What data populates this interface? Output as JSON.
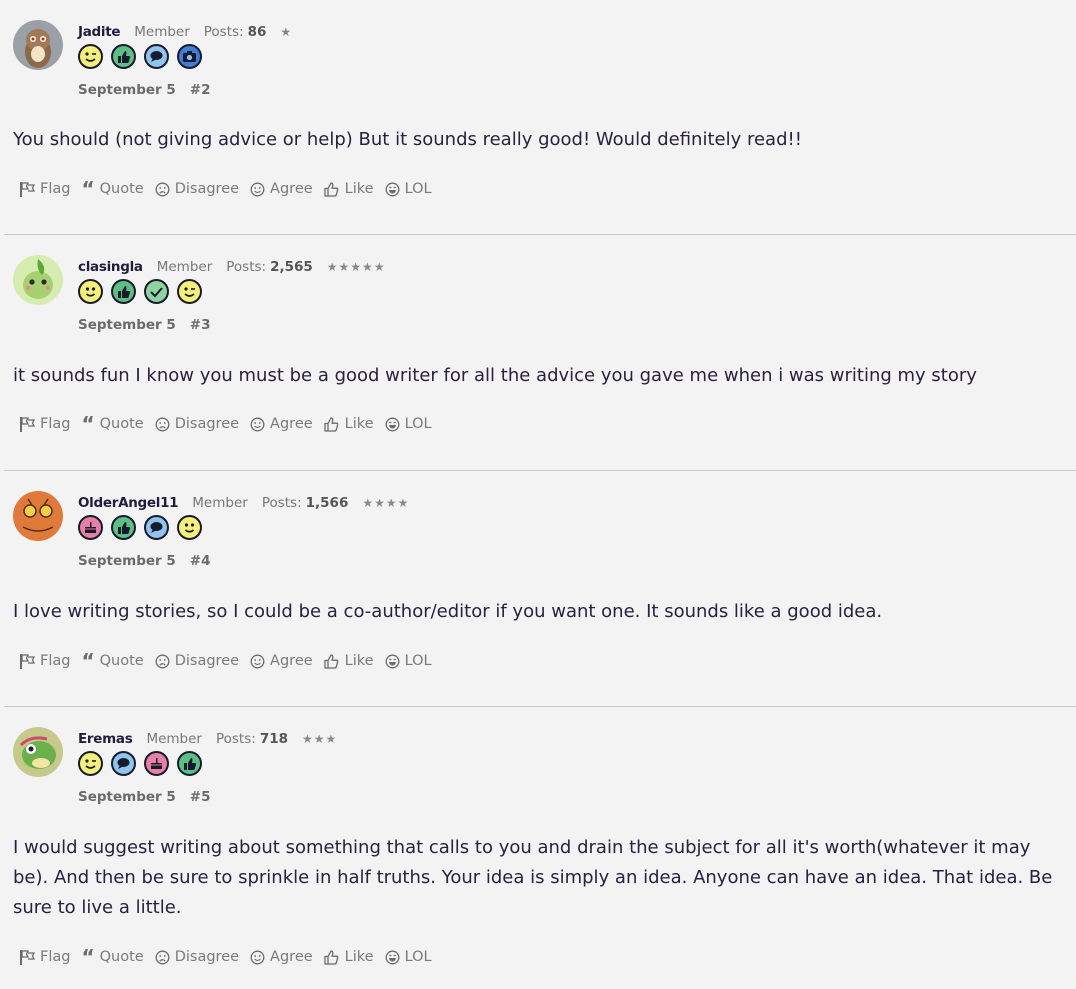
{
  "actions": {
    "flag": "Flag",
    "quote": "Quote",
    "disagree": "Disagree",
    "agree": "Agree",
    "like": "Like",
    "lol": "LOL"
  },
  "posts": [
    {
      "username": "Jadite",
      "role": "Member",
      "posts_label": "Posts:",
      "posts_count": "86",
      "stars": "★",
      "date": "September 5",
      "number": "#2",
      "badges": [
        "wink-emoji",
        "thumbs-up",
        "speech-bubble",
        "camera"
      ],
      "body": "You should (not giving advice or help) But it sounds really good! Would definitely read!!"
    },
    {
      "username": "clasingla",
      "role": "Member",
      "posts_label": "Posts:",
      "posts_count": "2,565",
      "stars": "★★★★★",
      "date": "September 5",
      "number": "#3",
      "badges": [
        "smile-emoji",
        "thumbs-up",
        "check-mark",
        "wink-emoji"
      ],
      "body": "it sounds fun I know you must be a good writer for all the advice you gave me when i was writing my story"
    },
    {
      "username": "OlderAngel11",
      "role": "Member",
      "posts_label": "Posts:",
      "posts_count": "1,566",
      "stars": "★★★★",
      "date": "September 5",
      "number": "#4",
      "badges": [
        "cake",
        "thumbs-up",
        "speech-bubble",
        "smile-emoji"
      ],
      "body": "I love writing stories, so I could be a co-author/editor if you want one. It sounds like a good idea."
    },
    {
      "username": "Eremas",
      "role": "Member",
      "posts_label": "Posts:",
      "posts_count": "718",
      "stars": "★★★",
      "date": "September 5",
      "number": "#5",
      "badges": [
        "wink-emoji",
        "speech-bubble",
        "cake",
        "thumbs-up"
      ],
      "body": "I would suggest writing about something that calls to you and drain the subject for all it's worth(whatever it may be). And then be sure to sprinkle in half truths. Your idea is simply an idea. Anyone can have an idea. That idea. Be sure to live a little."
    }
  ],
  "colors": {
    "background": "#f3f3f3",
    "text": "#2a2040",
    "muted": "#777777",
    "divider": "#c9c9c9",
    "badge_yellow": "#f4ef7a",
    "badge_green": "#5cbf84",
    "badge_blue": "#8fc4ec",
    "badge_pink": "#e87fa6"
  }
}
